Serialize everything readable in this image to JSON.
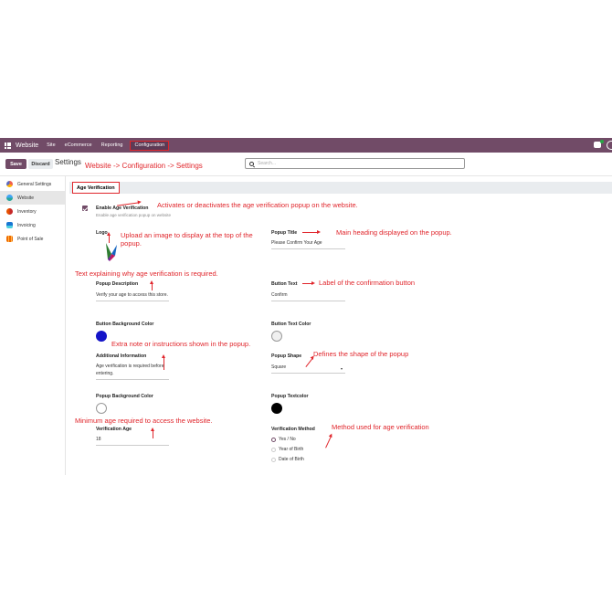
{
  "topbar": {
    "app_name": "Website",
    "menu": [
      "Site",
      "eCommerce",
      "Reporting",
      "Configuration"
    ]
  },
  "toolbar": {
    "save_label": "Save",
    "discard_label": "Discard",
    "breadcrumb": "Settings",
    "search_placeholder": "Search..."
  },
  "sidebar": {
    "items": [
      {
        "label": "General Settings",
        "icon": "general-settings-icon",
        "color": "#f06050"
      },
      {
        "label": "Website",
        "icon": "website-icon",
        "color": "#1e88e5"
      },
      {
        "label": "Inventory",
        "icon": "inventory-icon",
        "color": "#e65100"
      },
      {
        "label": "Invoicing",
        "icon": "invoicing-icon",
        "color": "#1976d2"
      },
      {
        "label": "Point of Sale",
        "icon": "point-of-sale-icon",
        "color": "#ef6c00"
      }
    ]
  },
  "section": {
    "title": "Age Verification"
  },
  "settings": {
    "enable_label": "Enable Age Verification",
    "enable_desc": "Enable age verification popup on website",
    "logo_label": "Logo",
    "popup_title_label": "Popup Title",
    "popup_title_value": "Please Confirm Your Age",
    "popup_desc_label": "Popup Description",
    "popup_desc_value": "Verify your age to access this store.",
    "button_text_label": "Button Text",
    "button_text_value": "Confirm",
    "button_bg_label": "Button Background Color",
    "button_text_color_label": "Button Text Color",
    "additional_info_label": "Additional Information",
    "additional_info_value": "Age verification is required before entering.",
    "popup_shape_label": "Popup Shape",
    "popup_shape_value": "Square",
    "popup_bg_label": "Popup Background Color",
    "popup_textcolor_label": "Popup Textcolor",
    "verification_age_label": "Verification Age",
    "verification_age_value": "18",
    "verification_method_label": "Verification Method",
    "methods": [
      "Yes / No",
      "Year of Birth",
      "Date of Birth"
    ],
    "colors": {
      "button_bg": "#1414c8",
      "button_text": "#f0f0f0",
      "popup_bg": "#ffffff",
      "popup_text": "#000000"
    }
  },
  "annotations": {
    "nav_path": "Website -> Configuration -> Settings",
    "enable": "Activates or deactivates the age verification popup on the website.",
    "logo": "Upload an image to display at the top of the popup.",
    "title": "Main heading displayed on the popup.",
    "description": "Text explaining why age verification is required.",
    "button_text": "Label of the confirmation button",
    "additional": "Extra note or instructions shown in the popup.",
    "shape": "Defines the shape of the popup",
    "age": "Minimum age required to access the website.",
    "method": "Method used for age verification"
  }
}
